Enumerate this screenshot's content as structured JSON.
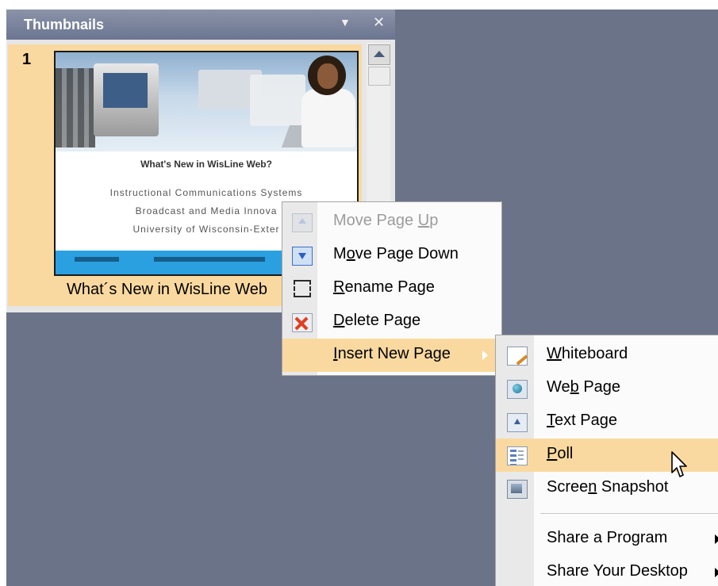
{
  "thumbnails_pane": {
    "title": "Thumbnails",
    "menu_icon": "dropdown-arrow-icon",
    "close_icon": "close-icon",
    "items": [
      {
        "page_number": "1",
        "caption": "What´s New in WisLine Web",
        "slide": {
          "title": "What's New in WisLine Web?",
          "lines": [
            "Instructional Communications Systems",
            "Broadcast and Media Innova",
            "University of Wisconsin-Exter"
          ]
        }
      }
    ]
  },
  "context_menu": {
    "items": [
      {
        "label": "Move Page Up",
        "mnemonic": "U",
        "icon": "move-up-icon",
        "enabled": false
      },
      {
        "label": "Move Page Down",
        "mnemonic": "o",
        "icon": "move-down-icon",
        "enabled": true
      },
      {
        "label": "Rename Page",
        "mnemonic": "R",
        "icon": "rename-icon",
        "enabled": true
      },
      {
        "label": "Delete Page",
        "mnemonic": "D",
        "icon": "delete-icon",
        "enabled": true
      },
      {
        "label": "Insert New Page",
        "mnemonic": "I",
        "icon": "",
        "enabled": true,
        "highlighted": true,
        "has_submenu": true
      }
    ]
  },
  "submenu": {
    "items": [
      {
        "label": "Whiteboard",
        "mnemonic": "W",
        "icon": "whiteboard-icon"
      },
      {
        "label": "Web Page",
        "mnemonic": "b",
        "icon": "web-page-icon"
      },
      {
        "label": "Text Page",
        "mnemonic": "T",
        "icon": "text-page-icon"
      },
      {
        "label": "Poll",
        "mnemonic": "P",
        "icon": "poll-icon",
        "highlighted": true
      },
      {
        "label": "Screen Snapshot",
        "mnemonic": "n",
        "icon": "screen-snapshot-icon"
      },
      {
        "label": "Share a Program",
        "icon": "",
        "has_submenu": true
      },
      {
        "label": "Share Your Desktop",
        "icon": "",
        "has_submenu": true
      }
    ]
  },
  "colors": {
    "background": "#6b7388",
    "highlight": "#fad9a0",
    "pane_header": "#7a839a",
    "disabled_text": "#9c9c9c"
  }
}
